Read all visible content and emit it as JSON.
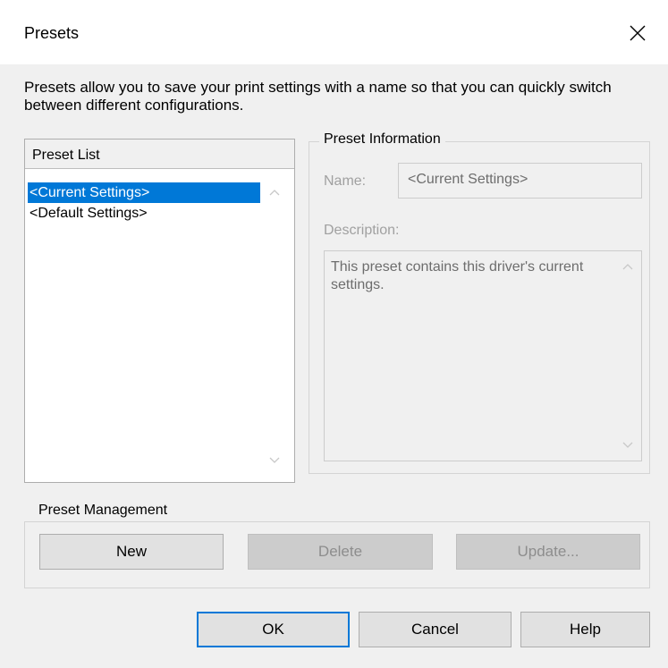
{
  "window": {
    "title": "Presets",
    "close_icon": "close-icon"
  },
  "intro_text": "Presets allow you to save your print settings with a name so that you can quickly switch between different configurations.",
  "preset_list": {
    "header": "Preset List",
    "items": [
      {
        "label": "<Current Settings>",
        "selected": true
      },
      {
        "label": "<Default Settings>",
        "selected": false
      }
    ]
  },
  "preset_info": {
    "legend": "Preset Information",
    "name_label": "Name:",
    "name_value": "<Current Settings>",
    "description_label": "Description:",
    "description_value": "This preset contains this driver's current settings."
  },
  "management": {
    "legend": "Preset Management",
    "new_label": "New",
    "delete_label": "Delete",
    "update_label": "Update..."
  },
  "footer": {
    "ok_label": "OK",
    "cancel_label": "Cancel",
    "help_label": "Help"
  },
  "colors": {
    "selection": "#0078d7",
    "dialog_bg": "#f0f0f0",
    "disabled_text": "#a0a0a0"
  }
}
